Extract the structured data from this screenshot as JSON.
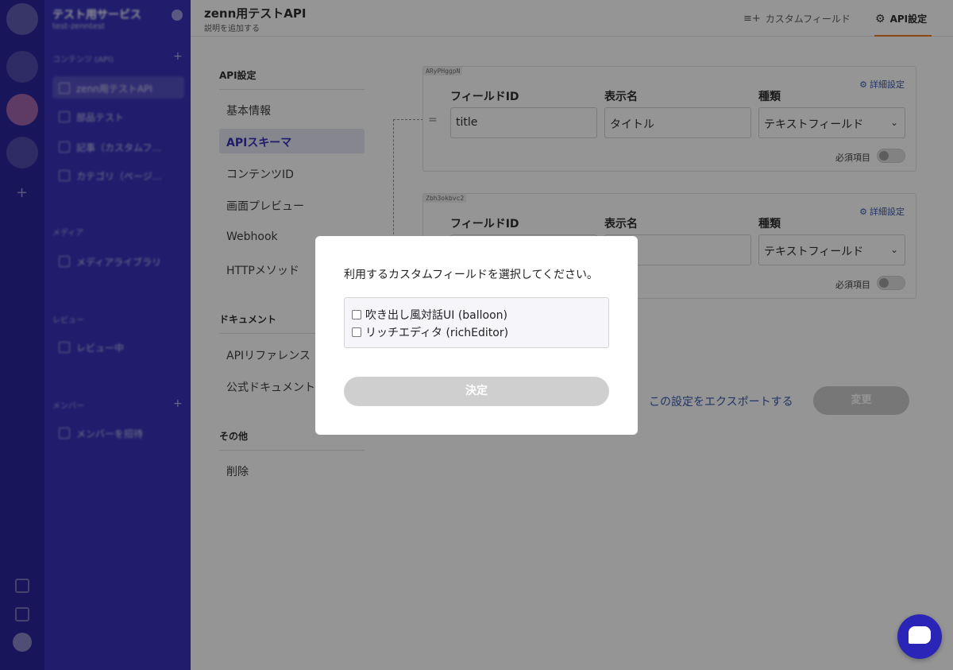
{
  "sidebar": {
    "service_name": "テスト用サービス",
    "service_id": "test-zenntest",
    "section_contents": "コンテンツ (API)",
    "items": [
      {
        "label": "zenn用テストAPI"
      },
      {
        "label": "部品テスト"
      },
      {
        "label": "記事（カスタムフ…"
      },
      {
        "label": "カテゴリ（ページ…"
      }
    ],
    "section_media": "メディア",
    "media_item": "メディアライブラリ",
    "section_review": "レビュー",
    "review_item": "レビュー中",
    "section_members": "メンバー",
    "members_item": "メンバーを招待"
  },
  "header": {
    "api_title": "zenn用テストAPI",
    "api_desc": "説明を追加する",
    "tab_custom_field": "カスタムフィールド",
    "tab_api_settings": "API設定"
  },
  "nav": {
    "head_api": "API設定",
    "basic_info": "基本情報",
    "api_schema": "APIスキーマ",
    "content_id": "コンテンツID",
    "preview": "画面プレビュー",
    "webhook": "Webhook",
    "http_method": "HTTPメソッド",
    "head_docs": "ドキュメント",
    "api_reference": "APIリファレンス",
    "official_docs": "公式ドキュメント",
    "head_other": "その他",
    "delete": "削除"
  },
  "fields": [
    {
      "tag": "ARyPHggpN",
      "detail_link": "詳細設定",
      "label_id": "フィールドID",
      "label_name": "表示名",
      "label_kind": "種類",
      "field_id": "title",
      "display_name": "タイトル",
      "kind": "テキストフィールド",
      "required_label": "必須項目"
    },
    {
      "tag": "Zbh3okbvc2",
      "detail_link": "詳細設定",
      "label_id": "フィールドID",
      "label_name": "表示名",
      "label_kind": "種類",
      "kind": "テキストフィールド",
      "required_label": "必須項目"
    }
  ],
  "actions": {
    "export": "この設定をエクスポートする",
    "change": "変更"
  },
  "modal": {
    "prompt": "利用するカスタムフィールドを選択してください。",
    "options": [
      {
        "label": "吹き出し風対話UI (balloon)",
        "checked": false
      },
      {
        "label": "リッチエディタ (richEditor)",
        "checked": false
      }
    ],
    "confirm": "決定"
  },
  "colors": {
    "brand": "#2a25b6",
    "accent_underline": "#e8740c",
    "link": "#2d4fa8"
  }
}
